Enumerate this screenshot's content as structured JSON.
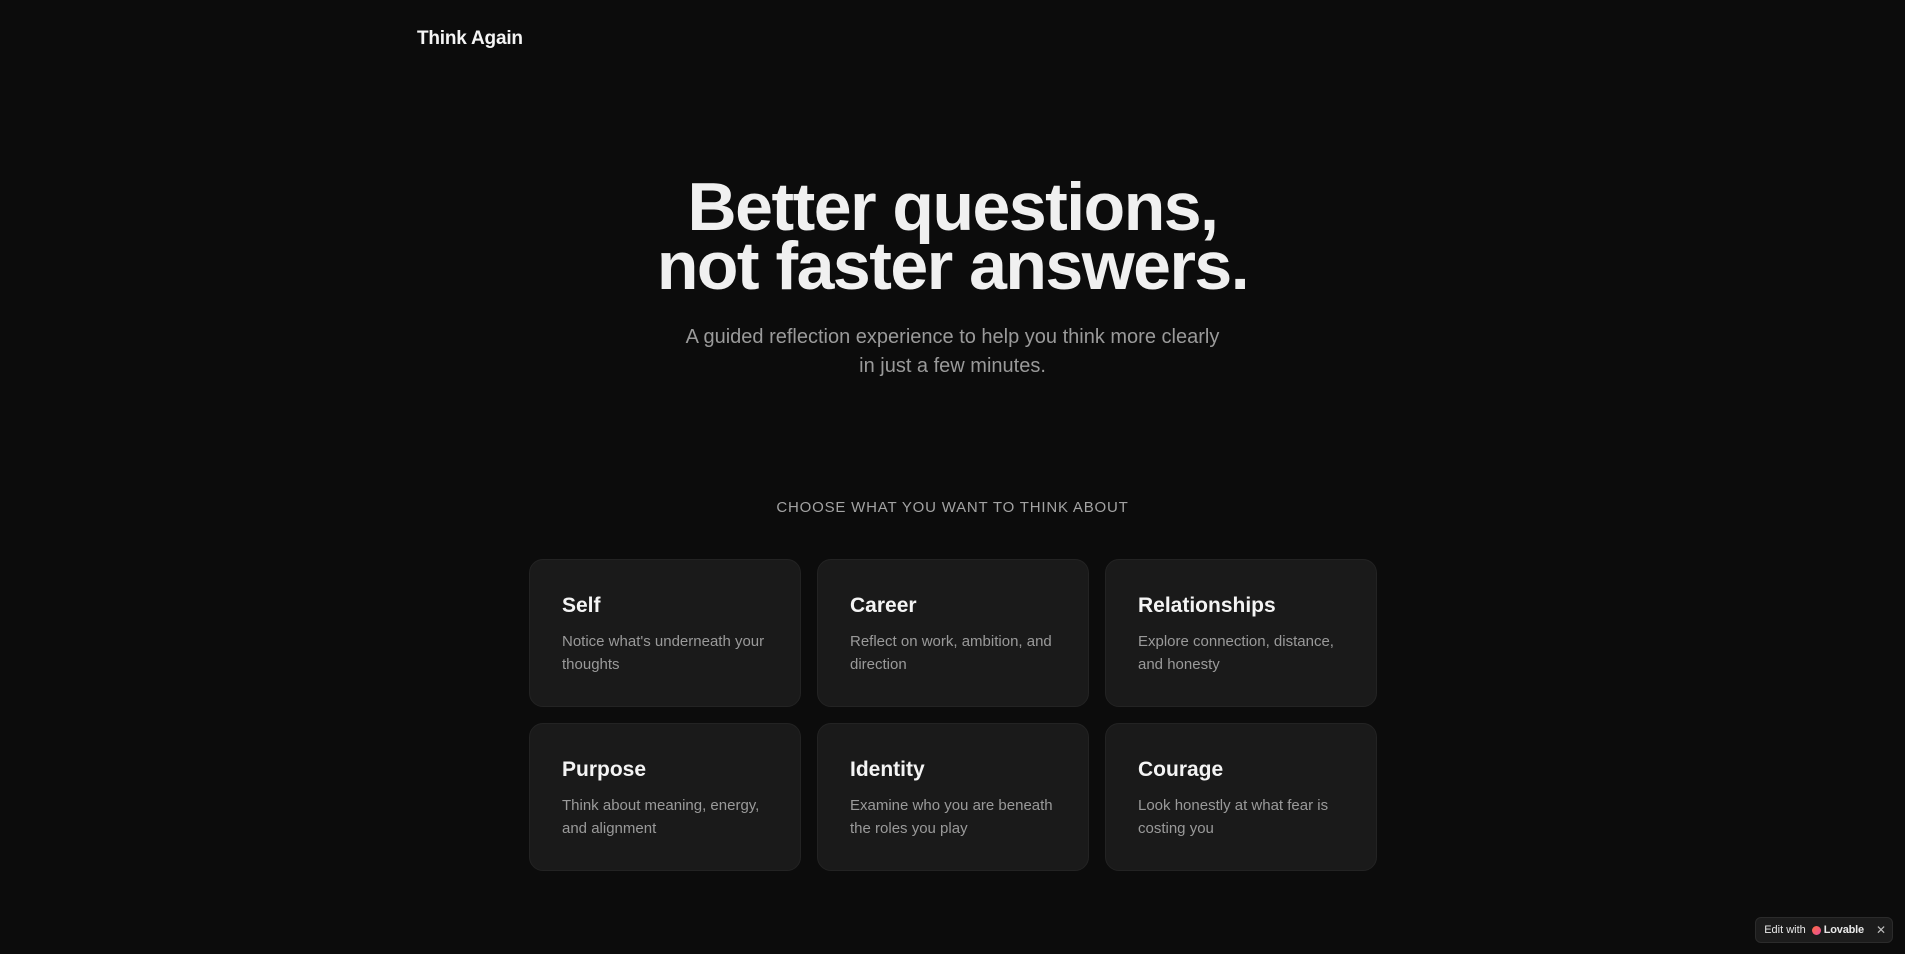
{
  "header": {
    "logo": "Think Again"
  },
  "hero": {
    "title_line1": "Better questions,",
    "title_line2": "not faster answers.",
    "subtitle": "A guided reflection experience to help you think more clearly in just a few minutes."
  },
  "topics": {
    "label": "CHOOSE WHAT YOU WANT TO THINK ABOUT",
    "items": [
      {
        "title": "Self",
        "description": "Notice what's underneath your thoughts"
      },
      {
        "title": "Career",
        "description": "Reflect on work, ambition, and direction"
      },
      {
        "title": "Relationships",
        "description": "Explore connection, distance, and honesty"
      },
      {
        "title": "Purpose",
        "description": "Think about meaning, energy, and alignment"
      },
      {
        "title": "Identity",
        "description": "Examine who you are beneath the roles you play"
      },
      {
        "title": "Courage",
        "description": "Look honestly at what fear is costing you"
      }
    ]
  },
  "badge": {
    "edit_label": "Edit with",
    "brand": "Lovable",
    "close_icon": "close-icon",
    "close_glyph": "✕"
  },
  "colors": {
    "background": "#0c0c0c",
    "card": "#1a1a1a",
    "muted_text": "#9a9a9a"
  }
}
